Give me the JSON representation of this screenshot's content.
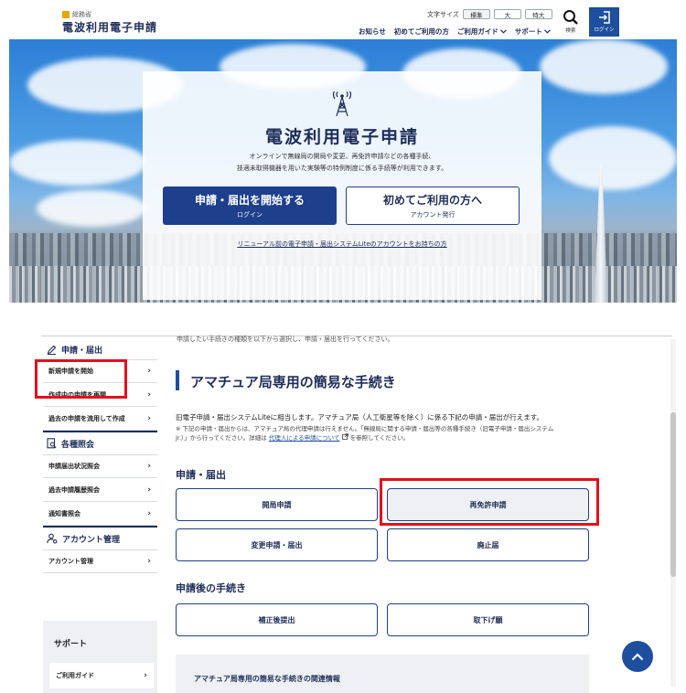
{
  "header": {
    "ministry": "総務省",
    "site_title": "電波利用電子申請",
    "text_size_label": "文字サイズ",
    "text_sizes": [
      "標準",
      "大",
      "特大"
    ],
    "nav": [
      {
        "label": "お知らせ",
        "has_menu": false
      },
      {
        "label": "初めてご利用の方",
        "has_menu": false
      },
      {
        "label": "ご利用ガイド",
        "has_menu": true
      },
      {
        "label": "サポート",
        "has_menu": true
      }
    ],
    "search_label": "検索",
    "login_label": "ログイン"
  },
  "hero": {
    "title": "電波利用電子申請",
    "desc_line1": "オンラインで無線局の開局や変更、再免許申請などの各種手続、",
    "desc_line2": "技適未取得機器を用いた実験等の特例制度に係る手続等が利用できます。",
    "primary_button": {
      "title": "申請・届出を開始する",
      "sub": "ログイン"
    },
    "secondary_button": {
      "title": "初めてご利用の方へ",
      "sub": "アカウント発行"
    },
    "lite_link": "リニューアル前の電子申請・届出システムLiteのアカウントをお持ちの方"
  },
  "top_cut_text": "申請したい手続きの種類を以下から選択し、申請・届出を行ってください。",
  "sidebar": {
    "section1_title": "申請・届出",
    "section1_items": [
      "新規申請を開始",
      "作成中の申請を再開",
      "過去の申請を流用して作成"
    ],
    "section2_title": "各種照会",
    "section2_items": [
      "申請届出状況照会",
      "過去申請履歴照会",
      "通知書照会"
    ],
    "section3_title": "アカウント管理",
    "section3_items": [
      "アカウント管理"
    ],
    "support_title": "サポート",
    "support_items": [
      "ご利用ガイド"
    ]
  },
  "main": {
    "title": "アマチュア局専用の簡易な手続き",
    "desc": "旧電子申請・届出システムLiteに相当します。アマチュア局（人工衛星等を除く）に係る下記の申請・届出が行えます。",
    "note_line1": "※ 下記の申請・届出からは、アマチュア局の代理申請は行えません。「無線局に関する申請・届出等の各種手続き（旧電子申請・届出システム",
    "note_line2a": "Jr.）」から行ってください。詳細は",
    "note_link": "代理人による申請について",
    "note_line2b": "を参照してください。",
    "section1_title": "申請・届出",
    "section1_buttons": [
      "開局申請",
      "再免許申請",
      "変更申請・届出",
      "廃止届"
    ],
    "section2_title": "申請後の手続き",
    "section2_buttons": [
      "補正後提出",
      "取下げ願"
    ],
    "related_title": "アマチュア局専用の簡易な手続きの関連情報"
  },
  "colors": {
    "primary": "#1d3f8c",
    "accent_blue": "#1d4f9e",
    "highlight_red": "#e3101b",
    "text_navy": "#1e2d5a"
  },
  "icons": {
    "search": "magnifier",
    "login": "door-arrow",
    "antenna": "radio-tower",
    "to_top": "chevron-up"
  }
}
